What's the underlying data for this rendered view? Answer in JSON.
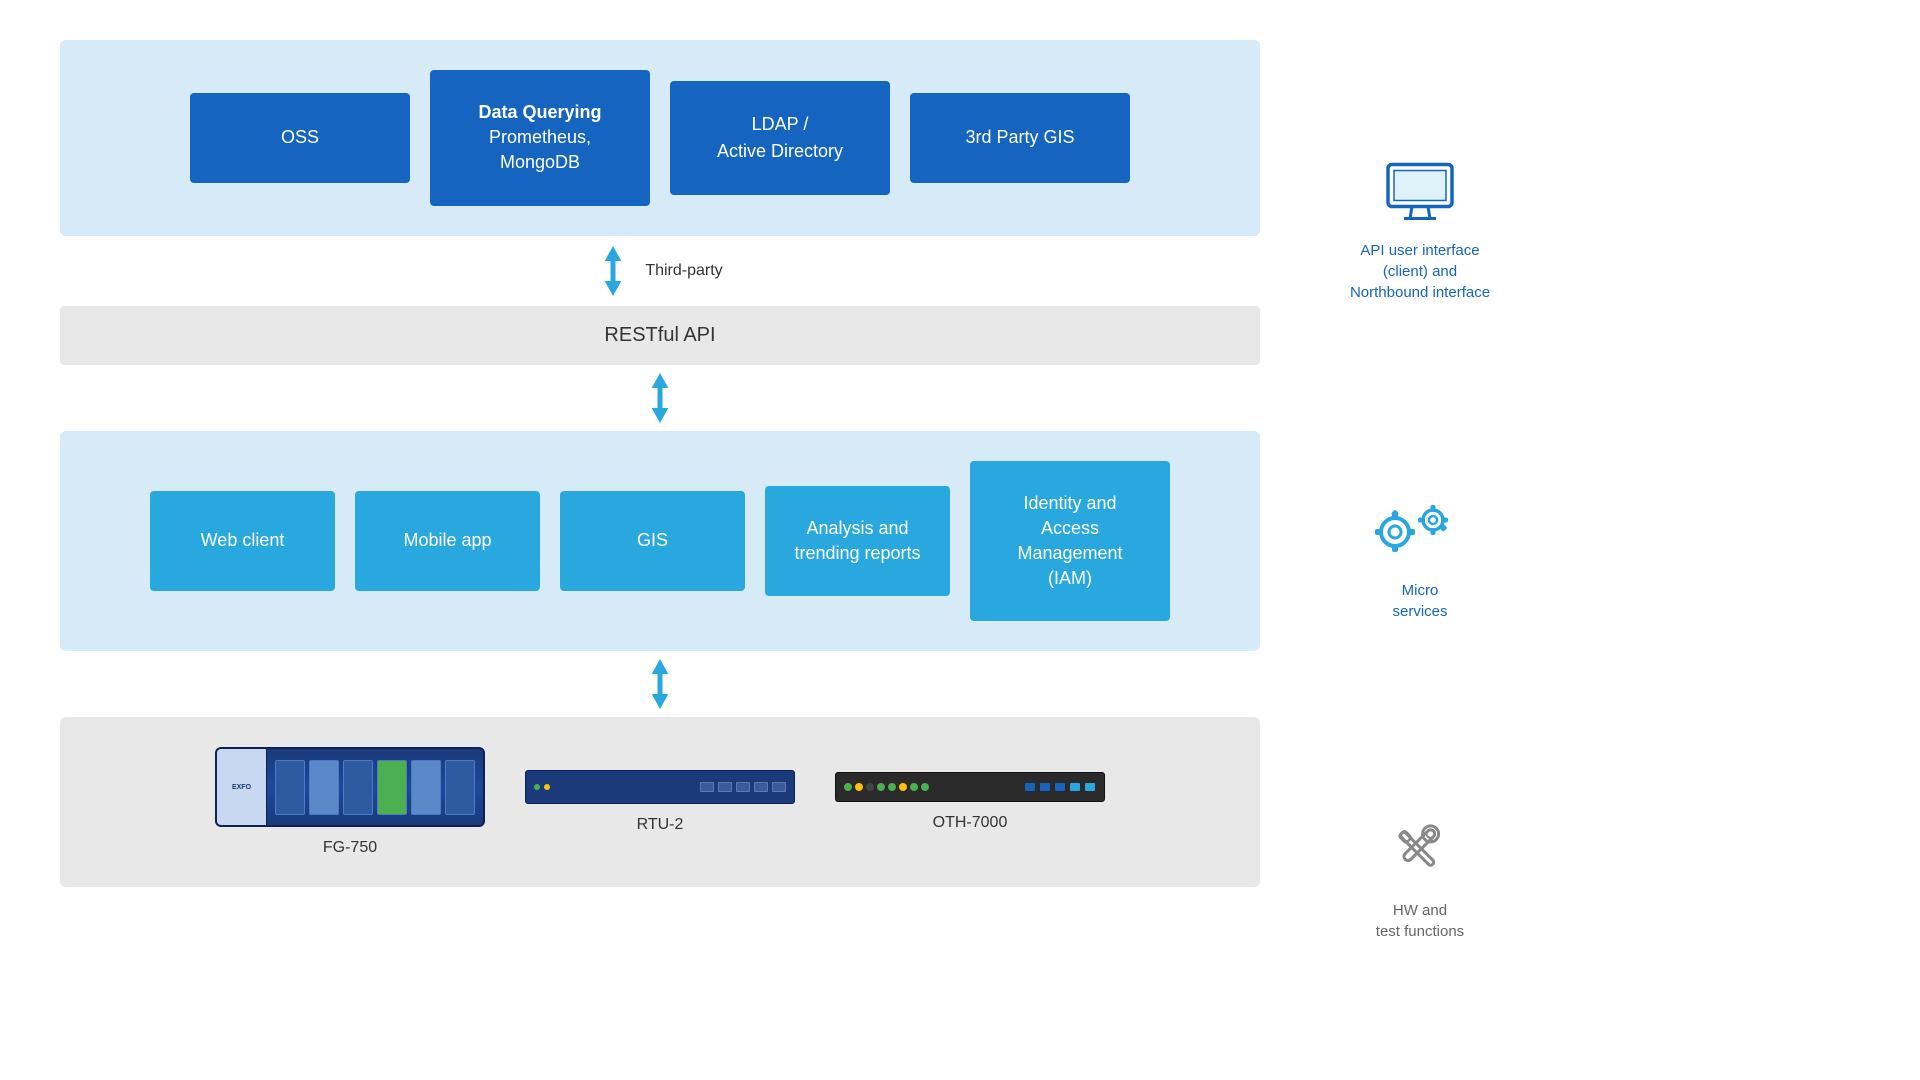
{
  "diagram": {
    "top_section": {
      "boxes": [
        {
          "id": "oss",
          "label": "OSS",
          "bold": false
        },
        {
          "id": "data-querying",
          "label": "Data Querying\nPrometheus,\nMongoDB",
          "bold_part": "Data Querying"
        },
        {
          "id": "ldap",
          "label": "LDAP /\nActive Directory",
          "bold": false
        },
        {
          "id": "gis-3rd",
          "label": "3rd Party GIS",
          "bold": false
        }
      ]
    },
    "arrow_third_party": "Third-party",
    "api_bar": "RESTful API",
    "middle_section": {
      "boxes": [
        {
          "id": "web-client",
          "label": "Web client"
        },
        {
          "id": "mobile-app",
          "label": "Mobile app"
        },
        {
          "id": "gis",
          "label": "GIS"
        },
        {
          "id": "analysis",
          "label": "Analysis and\ntrending reports"
        },
        {
          "id": "identity",
          "label": "Identity and\nAccess\nManagement\n(IAM)"
        }
      ]
    },
    "bottom_section": {
      "devices": [
        {
          "id": "fg750",
          "label": "FG-750",
          "type": "chassis"
        },
        {
          "id": "rtu2",
          "label": "RTU-2",
          "type": "1u"
        },
        {
          "id": "oth7000",
          "label": "OTH-7000",
          "type": "1u-dark"
        }
      ]
    }
  },
  "sidebar": {
    "items": [
      {
        "id": "api-ui",
        "icon": "monitor-icon",
        "label": "API user interface\n(client) and\nNorthbound interface",
        "color": "blue"
      },
      {
        "id": "micro-services",
        "icon": "gear-icon",
        "label": "Micro\nservices",
        "color": "blue"
      },
      {
        "id": "hw-test",
        "icon": "tools-icon",
        "label": "HW and\ntest functions",
        "color": "gray"
      }
    ]
  }
}
